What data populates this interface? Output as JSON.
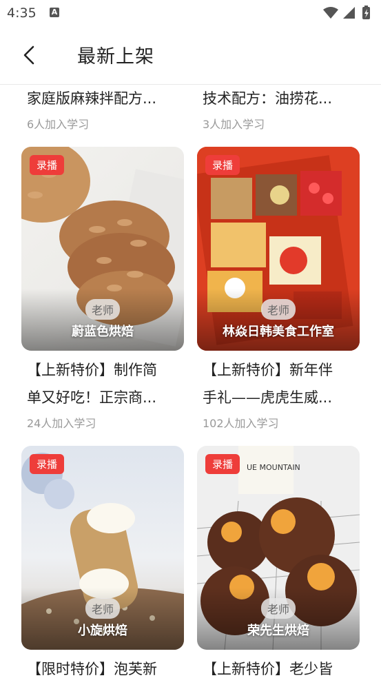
{
  "status": {
    "time": "4:35",
    "notif": "A"
  },
  "header": {
    "title": "最新上架"
  },
  "top_row": [
    {
      "title": "家庭版麻辣拌配方...",
      "learners": "6人加入学习"
    },
    {
      "title": "技术配方：油捞花...",
      "learners": "3人加入学习"
    }
  ],
  "cards": [
    {
      "badge": "录播",
      "teacher_tag": "老师",
      "teacher": "蔚蓝色烘焙",
      "line1": "【上新特价】制作简",
      "line2": "单又好吃！正宗商...",
      "learners": "24人加入学习"
    },
    {
      "badge": "录播",
      "teacher_tag": "老师",
      "teacher": "林焱日韩美食工作室",
      "line1": "【上新特价】新年伴",
      "line2": "手礼——虎虎生威...",
      "learners": "102人加入学习"
    },
    {
      "badge": "录播",
      "teacher_tag": "老师",
      "teacher": "小旋烘焙",
      "line1": "【限时特价】泡芙新",
      "line2": "",
      "learners": ""
    },
    {
      "badge": "录播",
      "teacher_tag": "老师",
      "teacher": "荣先生烘焙",
      "line1": "【上新特价】老少皆",
      "line2": "",
      "learners": "",
      "img_text": "UE MOUNTAIN"
    }
  ]
}
